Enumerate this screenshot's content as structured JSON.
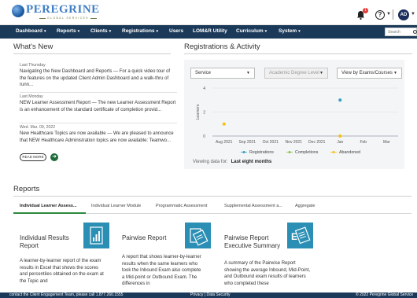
{
  "brand": {
    "name": "PEREGRINE",
    "tagline": "GLOBAL SERVICES"
  },
  "header": {
    "notification_count": "1",
    "help_symbol": "?",
    "user_initials": "AD"
  },
  "nav": {
    "items": [
      {
        "label": "Dashboard",
        "dropdown": true
      },
      {
        "label": "Reports",
        "dropdown": true
      },
      {
        "label": "Clients",
        "dropdown": true
      },
      {
        "label": "Registrations",
        "dropdown": true
      },
      {
        "label": "Users",
        "dropdown": false
      },
      {
        "label": "LOM&R Utility",
        "dropdown": false
      },
      {
        "label": "Curriculum",
        "dropdown": true
      },
      {
        "label": "System",
        "dropdown": true
      }
    ],
    "search_placeholder": "Search"
  },
  "whats_new": {
    "title": "What's New",
    "items": [
      {
        "date": "Last Thursday",
        "text": "Navigating the New Dashboard and Reports — For a quick video tour of the features on the updated Client Admin Dashboard and a walk-thru of runn..."
      },
      {
        "date": "Last Monday",
        "text": "NEW Learner Assessment Report — The new Learner Assessment Report is an enhancement of the standard certificate of completion provid..."
      },
      {
        "date": "Wed. Mar. 09, 2022",
        "text": "New Healthcare Topics are now available — We are pleased to announce that NEW Healthcare Administration topics are now available: Teamwo..."
      }
    ],
    "read_more": "READ MORE"
  },
  "activity": {
    "title": "Registrations & Activity",
    "filters": {
      "service": "Service",
      "degree_level": "Academic Degree Level",
      "view_by": "View by Exams/Courses"
    },
    "viewing_label": "Viewing data for:",
    "viewing_value": "Last eight months"
  },
  "chart_data": {
    "type": "scatter",
    "categories": [
      "Aug 2021",
      "Sep 2021",
      "Oct 2021",
      "Nov 2021",
      "Dec 2021",
      "Jan",
      "Feb",
      "Mar"
    ],
    "ylabel": "Learners",
    "ylim": [
      0,
      4
    ],
    "yticks": [
      0,
      2,
      4
    ],
    "series": [
      {
        "name": "Registrations",
        "color": "#3a9fbf",
        "points": [
          {
            "x": "Jan",
            "y": 3
          }
        ]
      },
      {
        "name": "Completions",
        "color": "#8bc34a",
        "points": []
      },
      {
        "name": "Abandoned",
        "color": "#f4c20d",
        "points": [
          {
            "x": "Aug 2021",
            "y": 1
          },
          {
            "x": "Jan",
            "y": 0
          }
        ]
      }
    ],
    "legend_position": "bottom"
  },
  "reports": {
    "title": "Reports",
    "tabs": [
      "Individual Learner Assess...",
      "Individual Learner Module",
      "Programmatic Assessment",
      "Supplemental Assessment a...",
      "Aggregate"
    ],
    "cards": [
      {
        "title": "Individual Results Report",
        "description": "A learner-by-learner report of the exam results in Excel that shows the scores and percentiles obtained on the exam at the Topic and",
        "icon": "excel-report-icon"
      },
      {
        "title": "Pairwise Report",
        "description": "A report that shows learner-by-learner results when the same learners who took the Inbound Exam also complete a Mid-point or Outbound Exam. The differences in",
        "icon": "pairwise-report-icon"
      },
      {
        "title": "Pairwise Report Executive Summary",
        "description": "A summary of the Pairwise Report showing the average Inbound, Mid-Point, and Outbound exam results of learners who completed these",
        "icon": "executive-summary-icon"
      }
    ]
  },
  "footer": {
    "contact": "contact the Client Engagement Team, please call 1.877.260.1555",
    "links": "Privacy  |  Data Security",
    "copyright": "© 2022 Peregrine Global Service"
  }
}
